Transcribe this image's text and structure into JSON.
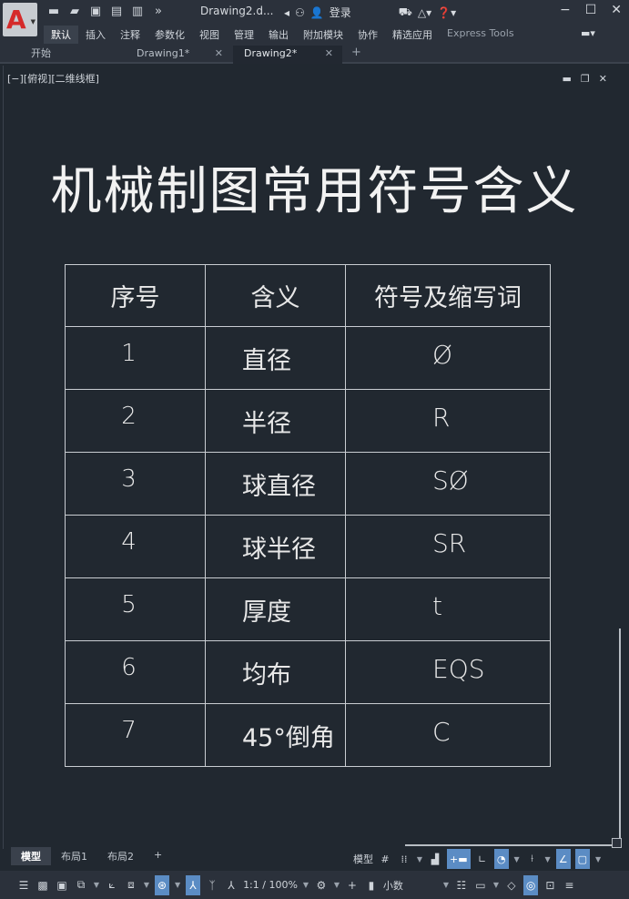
{
  "app": {
    "logo_letter": "A",
    "document_title": "Drawing2.d...",
    "login_label": "登录",
    "quick_access": [
      "new-icon",
      "open-icon",
      "save-icon",
      "save-as-icon",
      "plot-icon",
      "more-icon"
    ]
  },
  "ribbon": {
    "tabs": [
      {
        "label": "默认",
        "active": true
      },
      {
        "label": "插入"
      },
      {
        "label": "注释"
      },
      {
        "label": "参数化"
      },
      {
        "label": "视图"
      },
      {
        "label": "管理"
      },
      {
        "label": "输出"
      },
      {
        "label": "附加模块"
      },
      {
        "label": "协作"
      },
      {
        "label": "精选应用"
      },
      {
        "label": "Express Tools"
      }
    ]
  },
  "file_tabs": {
    "start": "开始",
    "items": [
      {
        "label": "Drawing1*",
        "active": false
      },
      {
        "label": "Drawing2*",
        "active": true
      }
    ],
    "close_glyph": "✕",
    "add_glyph": "+"
  },
  "viewport": {
    "label": "[−][俯视][二维线框]"
  },
  "drawing": {
    "title": "机械制图常用符号含义",
    "table": {
      "headers": [
        "序号",
        "含义",
        "符号及缩写词"
      ],
      "rows": [
        {
          "num": "1",
          "meaning": "直径",
          "symbol": "Ø"
        },
        {
          "num": "2",
          "meaning": "半径",
          "symbol": "R"
        },
        {
          "num": "3",
          "meaning": "球直径",
          "symbol": "SØ"
        },
        {
          "num": "4",
          "meaning": "球半径",
          "symbol": "SR"
        },
        {
          "num": "5",
          "meaning": "厚度",
          "symbol": "t"
        },
        {
          "num": "6",
          "meaning": "均布",
          "symbol": "EQS"
        },
        {
          "num": "7",
          "meaning": "45°倒角",
          "symbol": "C"
        }
      ]
    }
  },
  "layout_tabs": [
    {
      "label": "模型",
      "active": true
    },
    {
      "label": "布局1"
    },
    {
      "label": "布局2"
    },
    {
      "label": "+"
    }
  ],
  "status": {
    "model_label": "模型",
    "scale": "1:1 / 100%",
    "units": "小数"
  }
}
